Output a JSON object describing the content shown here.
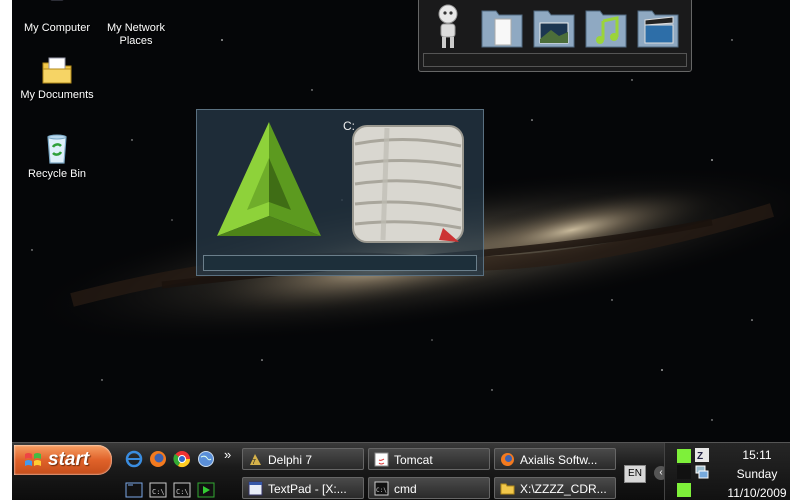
{
  "desktop": {
    "icons": [
      {
        "label": "My Computer",
        "icon": "my-computer-icon"
      },
      {
        "label": "My Network\nPlaces",
        "icon": "network-places-icon"
      },
      {
        "label": "My Documents",
        "icon": "my-documents-icon"
      },
      {
        "label": "Recycle Bin",
        "icon": "recycle-bin-icon"
      }
    ]
  },
  "dock": {
    "items": [
      {
        "icon": "robot-icon"
      },
      {
        "icon": "documents-folder-icon"
      },
      {
        "icon": "pictures-folder-icon"
      },
      {
        "icon": "music-folder-icon"
      },
      {
        "icon": "videos-folder-icon"
      }
    ]
  },
  "drive_panel": {
    "drive_label": "C:",
    "icons": [
      "green-pyramid-icon",
      "wrapped-drive-icon"
    ]
  },
  "taskbar": {
    "start_label": "start",
    "quick_launch": [
      "internet-explorer-icon",
      "firefox-icon",
      "chrome-icon",
      "globe-icon",
      "cmd-icon",
      "cmd-icon",
      "cmd-icon",
      "media-icon"
    ],
    "overflow_label": "»",
    "buttons": [
      {
        "label": "Delphi 7",
        "icon": "delphi-icon"
      },
      {
        "label": "Tomcat",
        "icon": "java-icon"
      },
      {
        "label": "Axialis Softw...",
        "icon": "firefox-icon"
      },
      {
        "label": "TextPad - [X:...",
        "icon": "textpad-icon"
      },
      {
        "label": "cmd",
        "icon": "cmd-icon"
      },
      {
        "label": "X:\\ZZZZ_CDR...",
        "icon": "folder-icon"
      }
    ],
    "language": "EN",
    "clock": {
      "time": "15:11",
      "day": "Sunday",
      "date": "11/10/2009"
    }
  },
  "colors": {
    "start_orange": "#e0622a",
    "taskbar": "#1b1b1b",
    "pyramid_green": "#7cc52a"
  }
}
